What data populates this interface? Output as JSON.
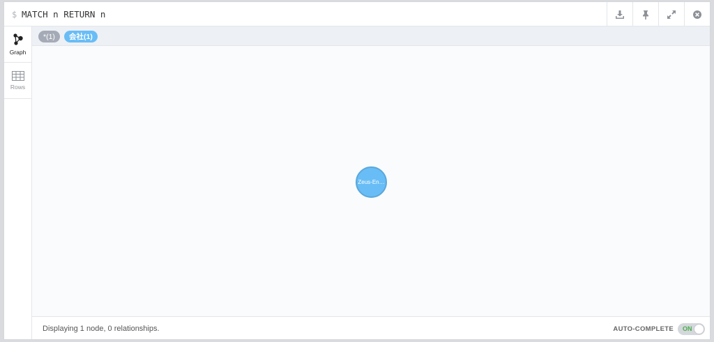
{
  "editor": {
    "prompt": "$",
    "query": "MATCH n RETURN n"
  },
  "toolbar": {
    "icons": [
      "download-icon",
      "pin-icon",
      "expand-icon",
      "close-circle-icon"
    ]
  },
  "sidebar": {
    "items": [
      {
        "label": "Graph",
        "icon": "graph-icon",
        "active": true
      },
      {
        "label": "Rows",
        "icon": "table-icon",
        "active": false
      }
    ]
  },
  "labels": {
    "all": "*(1)",
    "company": "会社(1)"
  },
  "graph": {
    "nodes": [
      {
        "caption": "Zeus-En…",
        "color": "#68bdf6"
      }
    ]
  },
  "status": {
    "text": "Displaying 1 node, 0 relationships.",
    "autocomplete_label": "AUTO-COMPLETE",
    "autocomplete_state": "ON"
  },
  "colors": {
    "node": "#68bdf6",
    "label_all": "#a5abb6",
    "toggle_on_text": "#4cae4c"
  }
}
